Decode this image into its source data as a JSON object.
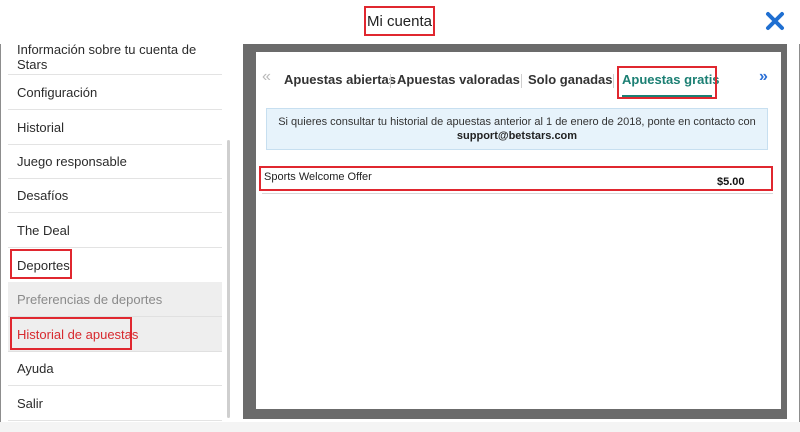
{
  "header": {
    "title": "Mi cuenta"
  },
  "sidebar": {
    "items": [
      {
        "label": "Información sobre tu cuenta de Stars"
      },
      {
        "label": "Configuración"
      },
      {
        "label": "Historial"
      },
      {
        "label": "Juego responsable"
      },
      {
        "label": "Desafíos"
      },
      {
        "label": "The Deal"
      },
      {
        "label": "Deportes"
      },
      {
        "label": "Preferencias de deportes"
      },
      {
        "label": "Historial de apuestas"
      },
      {
        "label": "Ayuda"
      },
      {
        "label": "Salir"
      }
    ]
  },
  "tabs": [
    {
      "label": "Apuestas abiertas"
    },
    {
      "label": "Apuestas valoradas"
    },
    {
      "label": "Solo ganadas"
    },
    {
      "label": "Apuestas gratis"
    }
  ],
  "notice": {
    "text": "Si quieres consultar tu historial de apuestas anterior al 1 de enero de 2018, ponte en contacto con",
    "email": "support@betstars.com"
  },
  "offers": [
    {
      "name": "Sports Welcome Offer",
      "amount": "$5.00"
    }
  ],
  "colors": {
    "highlight": "#e0272f",
    "active_tab": "#1b7f73",
    "link_arrow": "#2a6fd6",
    "close": "#1f6fd1"
  }
}
